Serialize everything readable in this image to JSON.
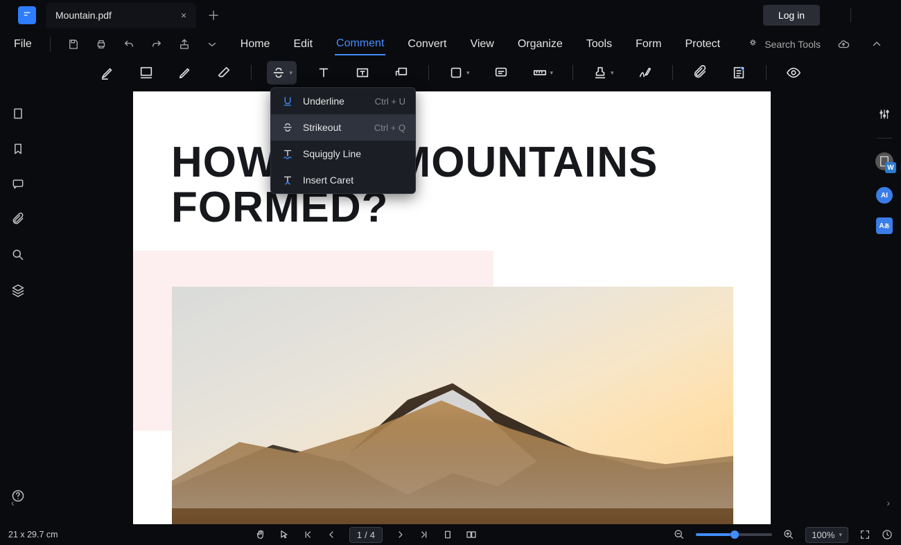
{
  "titlebar": {
    "tab_name": "Mountain.pdf",
    "login_label": "Log in"
  },
  "menubar": {
    "file": "File",
    "tabs": [
      "Home",
      "Edit",
      "Comment",
      "Convert",
      "View",
      "Organize",
      "Tools",
      "Form",
      "Protect"
    ],
    "active_tab": "Comment",
    "search_placeholder": "Search Tools"
  },
  "dropdown": {
    "items": [
      {
        "label": "Underline",
        "shortcut": "Ctrl + U",
        "icon": "underline"
      },
      {
        "label": "Strikeout",
        "shortcut": "Ctrl + Q",
        "icon": "strikeout",
        "hover": true
      },
      {
        "label": "Squiggly Line",
        "shortcut": "",
        "icon": "squiggly"
      },
      {
        "label": "Insert Caret",
        "shortcut": "",
        "icon": "caret"
      }
    ]
  },
  "document": {
    "heading": "HOW ARE MOUNTAINS FORMED?"
  },
  "right_rail": {
    "word_badge": "W",
    "ai_badge": "AI",
    "translate_badge": "A"
  },
  "statusbar": {
    "page_size": "21 x 29.7 cm",
    "current_page": "1",
    "total_pages": "4",
    "zoom_label": "100%"
  }
}
